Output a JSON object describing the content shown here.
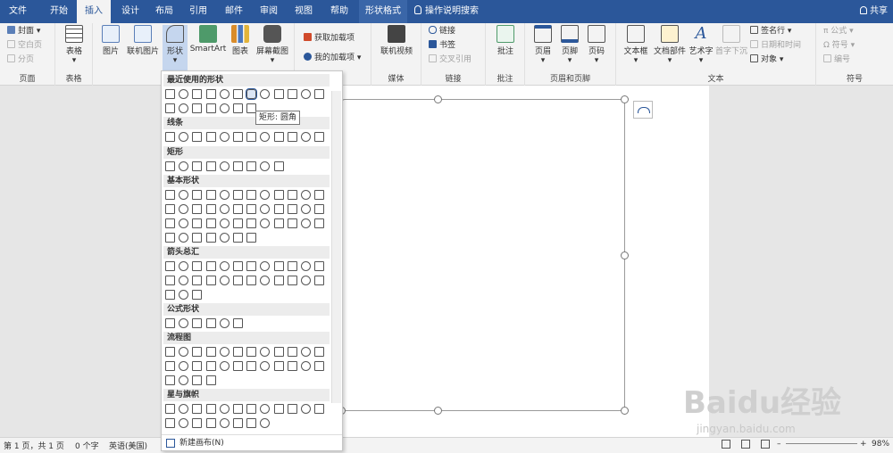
{
  "titlebar": {
    "tabs": [
      "文件",
      "开始",
      "插入",
      "设计",
      "布局",
      "引用",
      "邮件",
      "审阅",
      "视图",
      "帮助",
      "形状格式"
    ],
    "active_tab": "插入",
    "search_label": "操作说明搜索",
    "share_label": "共享"
  },
  "ribbon": {
    "groups": {
      "pages": {
        "label": "页面",
        "items": [
          "封面",
          "空白页",
          "分页"
        ]
      },
      "table": {
        "label": "表格",
        "item": "表格"
      },
      "illustrations": {
        "items": [
          "图片",
          "联机图片",
          "形状",
          "SmartArt",
          "图表",
          "屏幕截图"
        ]
      },
      "addins": {
        "items": [
          "获取加载项",
          "我的加载项"
        ]
      },
      "media": {
        "label": "媒体",
        "item": "联机视频"
      },
      "links": {
        "label": "链接",
        "items": [
          "链接",
          "书签",
          "交叉引用"
        ]
      },
      "comments": {
        "label": "批注",
        "item": "批注"
      },
      "headerfooter": {
        "label": "页眉和页脚",
        "items": [
          "页眉",
          "页脚",
          "页码"
        ]
      },
      "text": {
        "label": "文本",
        "items": [
          "文本框",
          "文档部件",
          "艺术字",
          "首字下沉"
        ],
        "small": [
          "签名行",
          "日期和时间",
          "对象"
        ]
      },
      "symbols": {
        "label": "符号",
        "items": [
          "公式",
          "符号",
          "编号"
        ]
      }
    }
  },
  "shapes_panel": {
    "sections": [
      "最近使用的形状",
      "线条",
      "矩形",
      "基本形状",
      "箭头总汇",
      "公式形状",
      "流程图",
      "星与旗帜"
    ],
    "tooltip": "矩形: 圆角",
    "new_canvas": "新建画布(N)"
  },
  "statusbar": {
    "page": "第 1 页，共 1 页",
    "words": "0 个字",
    "language": "英语(美国)",
    "zoom": "98%"
  },
  "watermark": {
    "line1": "Baidu经验",
    "line2": "jingyan.baidu.com"
  },
  "colors": {
    "accent": "#2b579a"
  }
}
